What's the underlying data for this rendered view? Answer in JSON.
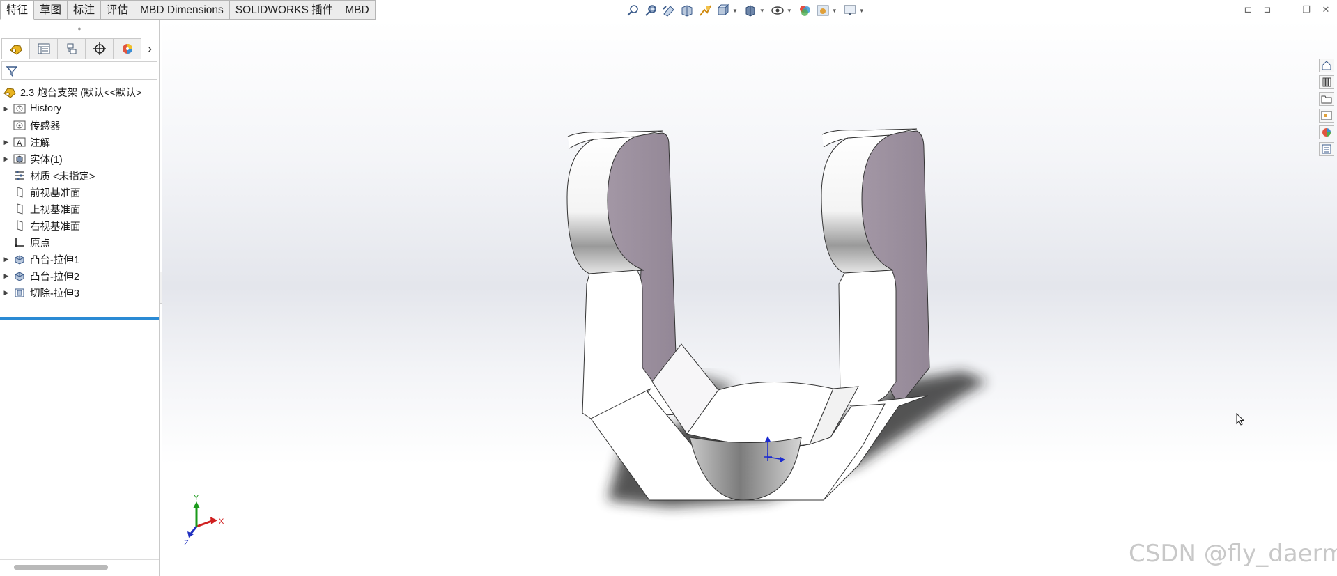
{
  "tabs": [
    "特征",
    "草图",
    "标注",
    "评估",
    "MBD Dimensions",
    "SOLIDWORKS 插件",
    "MBD"
  ],
  "active_tab": "特征",
  "feature_tree": {
    "root": "2.3 炮台支架 (默认<<默认>_",
    "items": [
      {
        "label": "History",
        "icon": "history-icon",
        "expandable": true
      },
      {
        "label": "传感器",
        "icon": "sensor-icon",
        "expandable": false
      },
      {
        "label": "注解",
        "icon": "annotation-icon",
        "expandable": true
      },
      {
        "label": "实体(1)",
        "icon": "solid-body-icon",
        "expandable": true
      },
      {
        "label": "材质 <未指定>",
        "icon": "material-icon",
        "expandable": false
      },
      {
        "label": "前视基准面",
        "icon": "plane-icon",
        "expandable": false
      },
      {
        "label": "上视基准面",
        "icon": "plane-icon",
        "expandable": false
      },
      {
        "label": "右视基准面",
        "icon": "plane-icon",
        "expandable": false
      },
      {
        "label": "原点",
        "icon": "origin-icon",
        "expandable": false
      },
      {
        "label": "凸台-拉伸1",
        "icon": "boss-extrude-icon",
        "expandable": true
      },
      {
        "label": "凸台-拉伸2",
        "icon": "boss-extrude-icon",
        "expandable": true
      },
      {
        "label": "切除-拉伸3",
        "icon": "cut-extrude-icon",
        "expandable": true
      }
    ]
  },
  "triad": {
    "x": "X",
    "y": "Y",
    "z": "Z"
  },
  "watermark": "CSDN @fly_daerm",
  "colors": {
    "accent": "#2a8ad4",
    "face_shaded": "#9a8e9c",
    "axis_x": "#d02020",
    "axis_y": "#1a9a1a",
    "axis_z": "#2030c0"
  }
}
